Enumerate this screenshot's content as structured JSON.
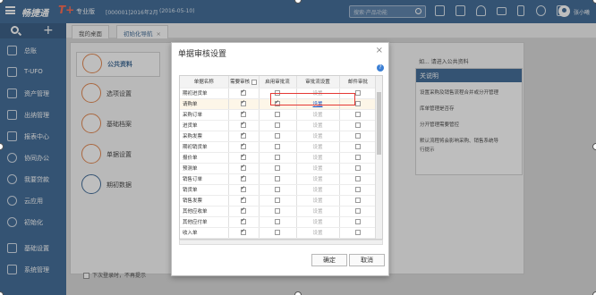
{
  "topbar": {
    "brand": "畅捷通",
    "brand_mark": "T+",
    "edition": "专业版",
    "account": "[000001]2016年2月",
    "date": "(2016-05-10)",
    "search_placeholder": "搜索·产品功能",
    "user_name": "张小曦"
  },
  "sidebar": {
    "items": [
      {
        "label": "总账",
        "icon": "ledger-icon"
      },
      {
        "label": "T-UFO",
        "icon": "report-icon"
      },
      {
        "label": "资产管理",
        "icon": "asset-icon"
      },
      {
        "label": "出纳管理",
        "icon": "cashier-icon"
      },
      {
        "label": "报表中心",
        "icon": "chart-icon"
      },
      {
        "label": "协同办公",
        "icon": "collab-icon"
      },
      {
        "label": "我要贷款",
        "icon": "loan-icon"
      },
      {
        "label": "云应用",
        "icon": "cloud-icon"
      },
      {
        "label": "初始化",
        "icon": "init-icon"
      },
      {
        "label": "基础设置",
        "icon": "settings-icon"
      },
      {
        "label": "系统管理",
        "icon": "system-icon"
      }
    ]
  },
  "tabs": [
    {
      "label": "我的桌面"
    },
    {
      "label": "初始化导航",
      "close": "×"
    }
  ],
  "main": {
    "nav": [
      {
        "label": "公共资料"
      },
      {
        "label": "选项设置"
      },
      {
        "label": "基础档案"
      },
      {
        "label": "单据设置"
      },
      {
        "label": "期初数据"
      }
    ],
    "hint": "如... 请进入公共资料",
    "card": {
      "title": "关说明",
      "lines": [
        "设置采购及销售流程合并或分开管理",
        "库单管理是否存",
        "分开管理需要管控",
        "默认流程将会影响采购、销售系统导",
        "行提示"
      ]
    },
    "footer_check": "下次登录时，不再提示"
  },
  "dialog": {
    "title": "单据审核设置",
    "close": "×",
    "help": "?",
    "headers": [
      "单据名称",
      "需要审核",
      "启用审批流",
      "审批流设置",
      "邮件审批"
    ],
    "rows": [
      {
        "name": "期初进货单",
        "review": true,
        "flow": false,
        "setting": "设置",
        "mail": false
      },
      {
        "name": "请购单",
        "review": true,
        "flow": true,
        "setting": "设置",
        "mail": false
      },
      {
        "name": "采购订单",
        "review": true,
        "flow": false,
        "setting": "设置",
        "mail": false
      },
      {
        "name": "进货单",
        "review": true,
        "flow": false,
        "setting": "设置",
        "mail": false
      },
      {
        "name": "采购发票",
        "review": true,
        "flow": false,
        "setting": "设置",
        "mail": false
      },
      {
        "name": "期初销货单",
        "review": true,
        "flow": false,
        "setting": "设置",
        "mail": false
      },
      {
        "name": "报价单",
        "review": true,
        "flow": false,
        "setting": "设置",
        "mail": false
      },
      {
        "name": "预测单",
        "review": true,
        "flow": false,
        "setting": "设置",
        "mail": false
      },
      {
        "name": "销售订单",
        "review": true,
        "flow": false,
        "setting": "设置",
        "mail": false
      },
      {
        "name": "销货单",
        "review": true,
        "flow": false,
        "setting": "设置",
        "mail": false
      },
      {
        "name": "销售发票",
        "review": true,
        "flow": false,
        "setting": "设置",
        "mail": false
      },
      {
        "name": "其他应收单",
        "review": true,
        "flow": false,
        "setting": "设置",
        "mail": false
      },
      {
        "name": "其他应付单",
        "review": true,
        "flow": false,
        "setting": "设置",
        "mail": false
      },
      {
        "name": "收入单",
        "review": true,
        "flow": false,
        "setting": "设置",
        "mail": false
      },
      {
        "name": "费用单",
        "review": true,
        "flow": false,
        "setting": "设置",
        "mail": false
      }
    ],
    "ok": "确定",
    "cancel": "取消"
  },
  "colors": {
    "brand": "#2b5b8c",
    "highlight": "#e53935",
    "link": "#1a55c2"
  }
}
